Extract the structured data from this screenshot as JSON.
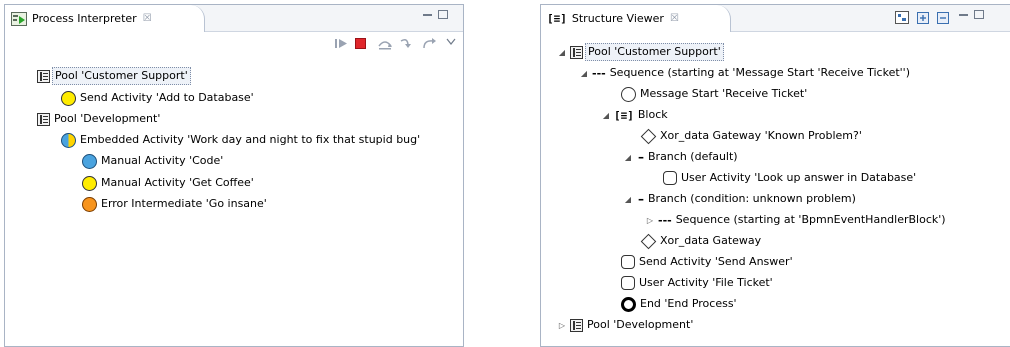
{
  "left_view": {
    "title": "Process Interpreter",
    "close_glyph": "☒",
    "tree": [
      {
        "label": "Pool 'Customer Support'",
        "icon": "pool-icon"
      },
      {
        "label": "Send Activity 'Add to Database'",
        "icon": "yellow-circle-icon"
      },
      {
        "label": "Pool 'Development'",
        "icon": "pool-icon"
      },
      {
        "label": "Embedded Activity 'Work day and night to fix that stupid bug'",
        "icon": "embedded-activity-icon"
      },
      {
        "label": "Manual Activity 'Code'",
        "icon": "blue-circle-icon"
      },
      {
        "label": "Manual Activity 'Get Coffee'",
        "icon": "yellow-circle-icon"
      },
      {
        "label": "Error Intermediate 'Go insane'",
        "icon": "orange-circle-icon"
      }
    ]
  },
  "right_view": {
    "title": "Structure Viewer",
    "close_glyph": "☒",
    "tree": [
      {
        "label": "Pool 'Customer Support'",
        "icon": "pool-icon"
      },
      {
        "label": "Sequence (starting at 'Message Start 'Receive Ticket'')",
        "icon": "sequence-icon"
      },
      {
        "label": "Message Start 'Receive Ticket'",
        "icon": "empty-circle-icon"
      },
      {
        "label": "Block",
        "icon": "block-icon"
      },
      {
        "label": "Xor_data Gateway 'Known Problem?'",
        "icon": "diamond-icon"
      },
      {
        "label": "Branch (default)",
        "icon": "branch-icon"
      },
      {
        "label": "User Activity 'Look up answer in Database'",
        "icon": "rounded-rect-icon"
      },
      {
        "label": "Branch (condition: unknown problem)",
        "icon": "branch-icon"
      },
      {
        "label": "Sequence (starting at 'BpmnEventHandlerBlock')",
        "icon": "sequence-icon"
      },
      {
        "label": "Xor_data Gateway",
        "icon": "diamond-icon"
      },
      {
        "label": "Send Activity 'Send Answer'",
        "icon": "rounded-rect-icon"
      },
      {
        "label": "User Activity 'File Ticket'",
        "icon": "rounded-rect-icon"
      },
      {
        "label": "End 'End Process'",
        "icon": "end-event-icon"
      },
      {
        "label": "Pool 'Development'",
        "icon": "pool-icon"
      }
    ]
  }
}
